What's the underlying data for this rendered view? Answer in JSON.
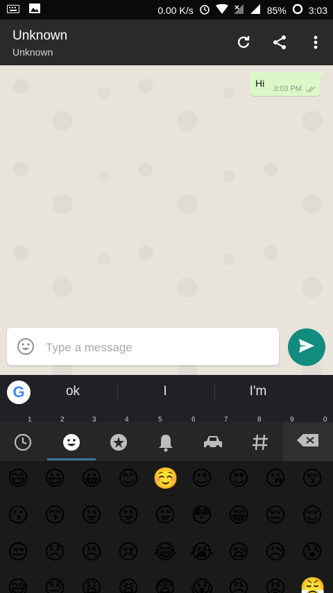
{
  "status_bar": {
    "speed": "0.00 K/s",
    "battery": "85%",
    "time": "3:03"
  },
  "app_bar": {
    "title": "Unknown",
    "subtitle": "Unknown",
    "icons": [
      "refresh-icon",
      "share-icon",
      "more-vert-icon"
    ]
  },
  "chat": {
    "messages": [
      {
        "text": "Hi",
        "time": "3:03 PM",
        "status": "double-check"
      }
    ]
  },
  "composer": {
    "placeholder": "Type a message"
  },
  "keyboard": {
    "suggestions": [
      "ok",
      "I",
      "I'm"
    ],
    "number_row": [
      "1",
      "2",
      "3",
      "4",
      "5",
      "6",
      "7",
      "8",
      "9",
      "0"
    ],
    "emoji_categories": [
      "recent",
      "smileys",
      "nature",
      "bell",
      "car",
      "symbols"
    ],
    "selected_category": "smileys",
    "emojis": [
      [
        "😄",
        "😃",
        "😀",
        "😊",
        "☺️",
        "😉",
        "😍",
        "😘",
        "😚"
      ],
      [
        "😗",
        "😙",
        "😜",
        "😝",
        "😛",
        "😳",
        "😁",
        "😔",
        "😌"
      ],
      [
        "😒",
        "😞",
        "😣",
        "😢",
        "😂",
        "😭",
        "😪",
        "😥",
        "😰"
      ],
      [
        "😅",
        "😓",
        "😩",
        "😫",
        "😨",
        "😱",
        "😠",
        "😡",
        "😤"
      ]
    ]
  },
  "colors": {
    "accent": "#128c7e",
    "bubble": "#dcf8c6",
    "appbar": "#2a2a2a"
  }
}
